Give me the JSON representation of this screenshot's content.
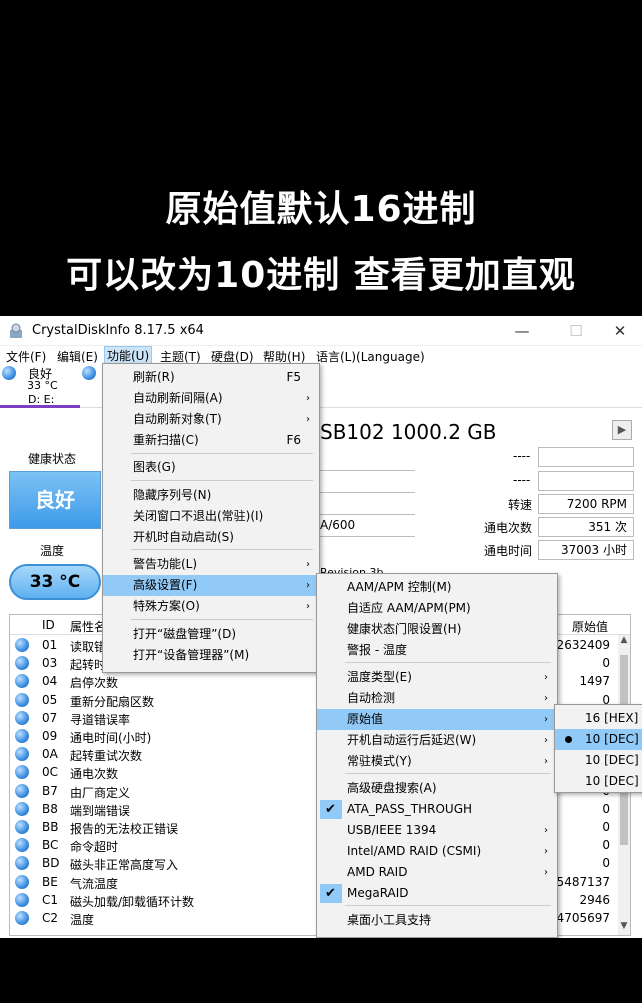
{
  "captions": [
    "原始值默认16进制",
    "可以改为10进制 查看更加直观"
  ],
  "window": {
    "title": "CrystalDiskInfo 8.17.5 x64",
    "minimize": "—",
    "maximize": "☐",
    "close": "✕"
  },
  "menubar": [
    "文件(F)",
    "编辑(E)",
    "功能(U)",
    "主题(T)",
    "硬盘(D)",
    "帮助(H)",
    "语言(L)(Language)"
  ],
  "drive": {
    "status": "良好",
    "temp": "33 °C",
    "letters": "D: E:"
  },
  "info": {
    "model": "SB102 1000.2 GB",
    "health_label": "健康状态",
    "health_value": "良好",
    "temp_label": "温度",
    "temp_value": "33 °C",
    "dash1": "----",
    "dash2": "----",
    "interface_partial": "A/600",
    "revision_partial": "Revision 3b",
    "rpm_label": "转速",
    "rpm_value": "7200 RPM",
    "power_count_label": "通电次数",
    "power_count_value": "351 次",
    "power_time_label": "通电时间",
    "power_time_value": "37003 小时"
  },
  "table": {
    "headers": {
      "id": "ID",
      "name": "属性名",
      "raw": "原始值"
    },
    "rows": [
      {
        "id": "01",
        "name": "读取错",
        "raw": "02632409"
      },
      {
        "id": "03",
        "name": "起转时",
        "raw": "0"
      },
      {
        "id": "04",
        "name": "启停次数",
        "raw": "1497"
      },
      {
        "id": "05",
        "name": "重新分配扇区数",
        "raw": "0"
      },
      {
        "id": "07",
        "name": "寻道错误率",
        "raw": "0"
      },
      {
        "id": "09",
        "name": "通电时间(小时)",
        "raw": "0"
      },
      {
        "id": "0A",
        "name": "起转重试次数",
        "raw": "0"
      },
      {
        "id": "0C",
        "name": "通电次数",
        "raw": "0"
      },
      {
        "id": "B7",
        "name": "由厂商定义",
        "raw": "0"
      },
      {
        "id": "B8",
        "name": "端到端错误",
        "raw": "0"
      },
      {
        "id": "BB",
        "name": "报告的无法校正错误",
        "raw": "0"
      },
      {
        "id": "BC",
        "name": "命令超时",
        "raw": "0"
      },
      {
        "id": "BD",
        "name": "磁头非正常高度写入",
        "raw": "0"
      },
      {
        "id": "BE",
        "name": "气流温度",
        "raw": "05487137"
      },
      {
        "id": "C1",
        "name": "磁头加载/卸载循环计数",
        "raw": "2946"
      },
      {
        "id": "C2",
        "name": "温度",
        "raw": "54705697"
      }
    ]
  },
  "menu1": [
    {
      "label": "刷新(R)",
      "key": "F5"
    },
    {
      "label": "自动刷新间隔(A)",
      "sub": "›"
    },
    {
      "label": "自动刷新对象(T)",
      "sub": "›"
    },
    {
      "label": "重新扫描(C)",
      "key": "F6"
    },
    {
      "label": "图表(G)"
    },
    {
      "label": "隐藏序列号(N)"
    },
    {
      "label": "关闭窗口不退出(常驻)(I)"
    },
    {
      "label": "开机时自动启动(S)"
    },
    {
      "label": "警告功能(L)",
      "sub": "›"
    },
    {
      "label": "高级设置(F)",
      "sub": "›"
    },
    {
      "label": "特殊方案(O)",
      "sub": "›"
    },
    {
      "label": "打开“磁盘管理”(D)"
    },
    {
      "label": "打开“设备管理器”(M)"
    }
  ],
  "menu2": [
    {
      "label": "AAM/APM 控制(M)"
    },
    {
      "label": "自适应 AAM/APM(PM)"
    },
    {
      "label": "健康状态门限设置(H)"
    },
    {
      "label": "警报 - 温度"
    },
    {
      "label": "温度类型(E)",
      "sub": "›"
    },
    {
      "label": "自动检测",
      "sub": "›"
    },
    {
      "label": "原始值",
      "sub": "›"
    },
    {
      "label": "开机自动运行后延迟(W)",
      "sub": "›"
    },
    {
      "label": "常驻模式(Y)",
      "sub": "›"
    },
    {
      "label": "高级硬盘搜索(A)"
    },
    {
      "label": "ATA_PASS_THROUGH",
      "check": "✔"
    },
    {
      "label": "USB/IEEE 1394",
      "sub": "›"
    },
    {
      "label": "Intel/AMD RAID (CSMI)",
      "sub": "›"
    },
    {
      "label": "AMD RAID",
      "sub": "›"
    },
    {
      "label": "MegaRAID",
      "check": "✔"
    },
    {
      "label": "桌面小工具支持"
    }
  ],
  "menu3": [
    "16 [HEX]",
    "10 [DEC]",
    "10 [DEC] -",
    "10 [DEC] -"
  ]
}
